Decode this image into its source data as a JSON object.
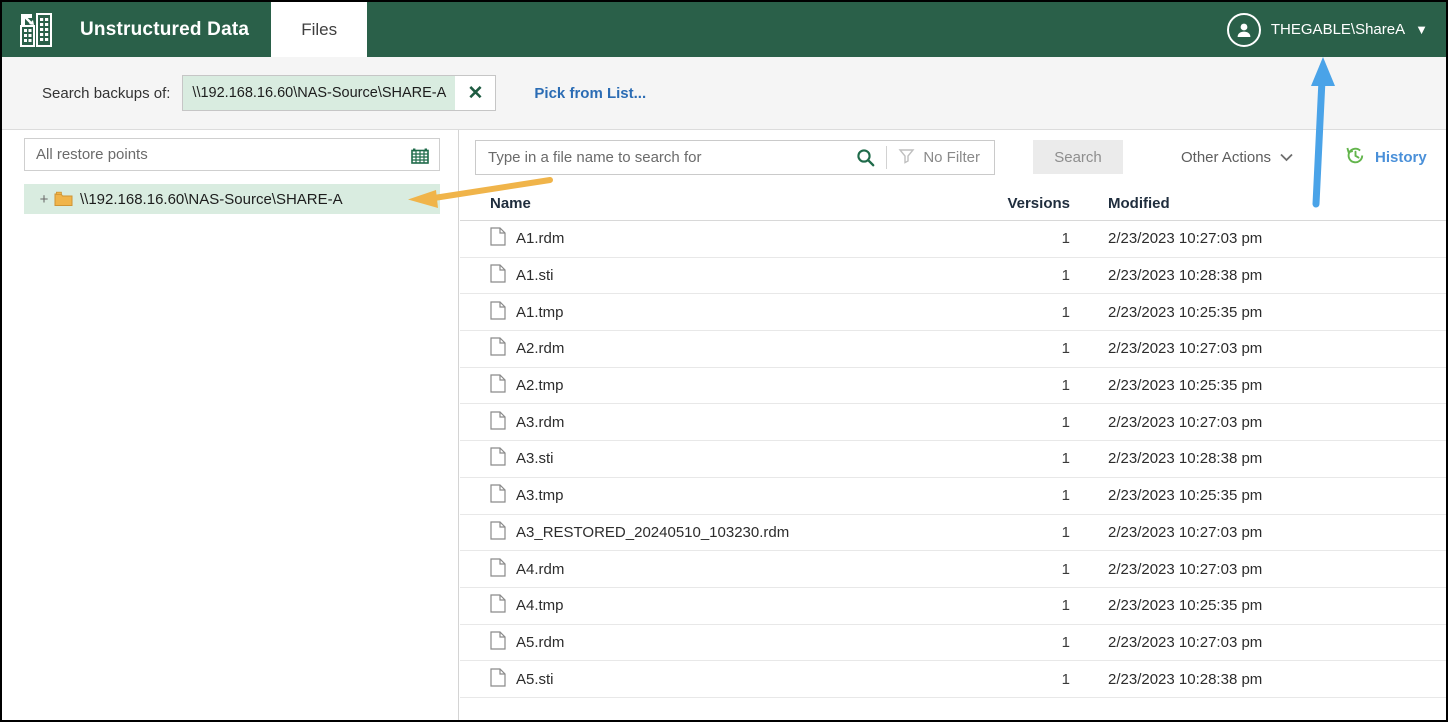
{
  "header": {
    "logo_icon": "veeam-unstructured-data-logo",
    "app_title": "Unstructured Data",
    "tabs": [
      {
        "label": "Files",
        "active": true
      }
    ],
    "account": {
      "avatar_icon": "user-avatar-icon",
      "name": "THEGABLE\\ShareA",
      "caret_icon": "chevron-down-icon"
    }
  },
  "backup_strip": {
    "label": "Search backups of:",
    "path_value": "\\\\192.168.16.60\\NAS-Source\\SHARE-A",
    "clear_icon": "close-x-icon",
    "pick_link": "Pick from List..."
  },
  "left_panel": {
    "restore_points": {
      "value": "All restore points",
      "calendar_icon": "calendar-icon"
    },
    "tree": [
      {
        "expander": "+",
        "folder_icon": "folder-icon",
        "label": "\\\\192.168.16.60\\NAS-Source\\SHARE-A",
        "selected": true
      }
    ]
  },
  "toolbar": {
    "search_placeholder": "Type in a file name to search for",
    "search_icon": "magnifier-icon",
    "filter_icon": "funnel-icon",
    "filter_label": "No Filter",
    "search_button": "Search",
    "other_actions": "Other Actions",
    "other_actions_caret": "chevron-down-icon",
    "history_icon": "history-clock-icon",
    "history_label": "History"
  },
  "table": {
    "columns": [
      "Name",
      "Versions",
      "Modified"
    ],
    "file_icon": "file-document-icon",
    "rows": [
      {
        "name": "A1.rdm",
        "versions": "1",
        "modified": "2/23/2023 10:27:03 pm"
      },
      {
        "name": "A1.sti",
        "versions": "1",
        "modified": "2/23/2023 10:28:38 pm"
      },
      {
        "name": "A1.tmp",
        "versions": "1",
        "modified": "2/23/2023 10:25:35 pm"
      },
      {
        "name": "A2.rdm",
        "versions": "1",
        "modified": "2/23/2023 10:27:03 pm"
      },
      {
        "name": "A2.tmp",
        "versions": "1",
        "modified": "2/23/2023 10:25:35 pm"
      },
      {
        "name": "A3.rdm",
        "versions": "1",
        "modified": "2/23/2023 10:27:03 pm"
      },
      {
        "name": "A3.sti",
        "versions": "1",
        "modified": "2/23/2023 10:28:38 pm"
      },
      {
        "name": "A3.tmp",
        "versions": "1",
        "modified": "2/23/2023 10:25:35 pm"
      },
      {
        "name": "A3_RESTORED_20240510_103230.rdm",
        "versions": "1",
        "modified": "2/23/2023 10:27:03 pm"
      },
      {
        "name": "A4.rdm",
        "versions": "1",
        "modified": "2/23/2023 10:27:03 pm"
      },
      {
        "name": "A4.tmp",
        "versions": "1",
        "modified": "2/23/2023 10:25:35 pm"
      },
      {
        "name": "A5.rdm",
        "versions": "1",
        "modified": "2/23/2023 10:27:03 pm"
      },
      {
        "name": "A5.sti",
        "versions": "1",
        "modified": "2/23/2023 10:28:38 pm"
      }
    ]
  },
  "annotations": [
    {
      "name": "yellow-arrow-to-tree-item",
      "color": "#f0b44a",
      "direction": "left"
    },
    {
      "name": "blue-arrow-to-account",
      "color": "#4aa3e8",
      "direction": "up"
    }
  ],
  "colors": {
    "header_green": "#2a6049",
    "selection_green": "#d9ece0",
    "link_blue": "#2b6cb4",
    "history_blue": "#4a90d9",
    "folder_orange": "#f0b44a"
  }
}
